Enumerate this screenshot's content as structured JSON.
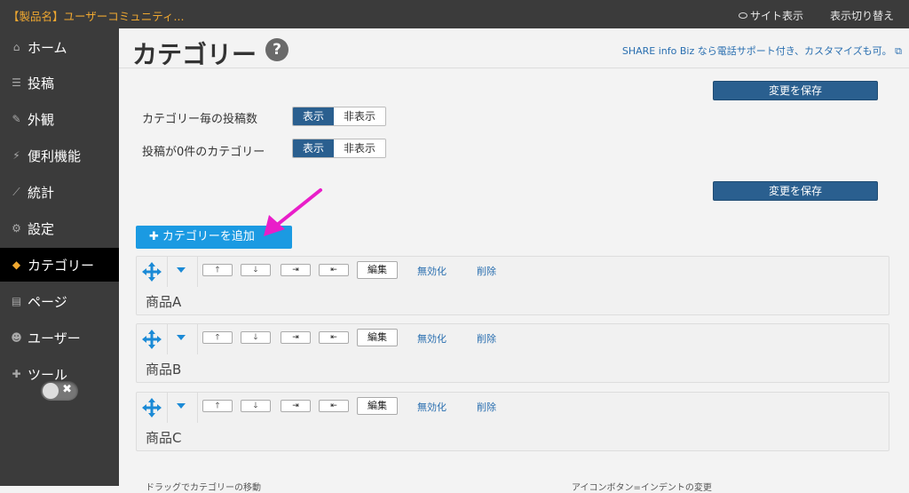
{
  "topbar": {
    "site_title": "【製品名】ユーザーコミュニティ...",
    "view_site": "サイト表示",
    "switch_display": "表示切り替え"
  },
  "sidebar": {
    "items": [
      {
        "label": "ホーム",
        "icon": "home-icon"
      },
      {
        "label": "投稿",
        "icon": "list-icon"
      },
      {
        "label": "外観",
        "icon": "brush-icon"
      },
      {
        "label": "便利機能",
        "icon": "plug-icon"
      },
      {
        "label": "統計",
        "icon": "chart-icon"
      },
      {
        "label": "設定",
        "icon": "gears-icon"
      },
      {
        "label": "カテゴリー",
        "icon": "tags-icon",
        "active": true
      },
      {
        "label": "ページ",
        "icon": "file-icon"
      },
      {
        "label": "ユーザー",
        "icon": "users-icon"
      },
      {
        "label": "ツール",
        "icon": "wrench-icon"
      }
    ]
  },
  "main": {
    "title": "カテゴリー",
    "help": "?",
    "promo": "SHARE info Biz なら電話サポート付き、カスタマイズも可。",
    "save_label": "変更を保存",
    "options": [
      {
        "label": "カテゴリー毎の投稿数",
        "on": "表示",
        "off": "非表示",
        "selected": "表示"
      },
      {
        "label": "投稿が0件のカテゴリー",
        "on": "表示",
        "off": "非表示",
        "selected": "表示"
      }
    ],
    "add_category": "カテゴリーを追加",
    "row_buttons": {
      "up": "🡑",
      "down": "🡓",
      "indent": "⇥",
      "outdent": "⇤",
      "edit": "編集",
      "disable": "無効化",
      "delete": "削除"
    },
    "categories": [
      "商品A",
      "商品B",
      "商品C"
    ],
    "bottom_left": "ドラッグでカテゴリーの移動",
    "bottom_right": "アイコンボタン=インデントの変更"
  },
  "colors": {
    "accent": "#1b9ae2",
    "save_button": "#2a5f8f",
    "sidebar_bg": "#3b3b3b",
    "title_orange": "#f0a830",
    "annotation_arrow": "#e91ec9"
  }
}
